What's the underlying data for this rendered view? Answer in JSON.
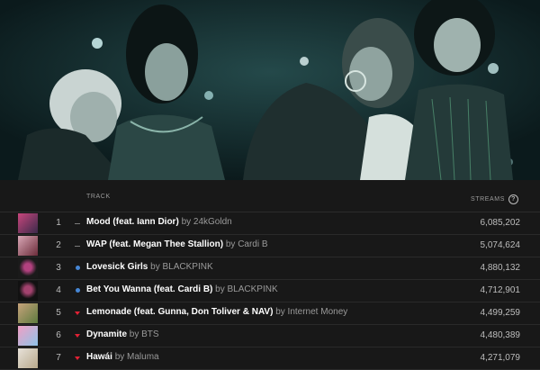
{
  "header": {
    "track_label": "TRACK",
    "streams_label": "STREAMS",
    "info_glyph": "?"
  },
  "by_word": "by",
  "rows": [
    {
      "rank": "1",
      "trend": "flat",
      "title": "Mood (feat. Iann Dior)",
      "artist": "24kGoldn",
      "streams": "6,085,202",
      "thumb_colors": [
        "#c8467c",
        "#3a2a4a"
      ]
    },
    {
      "rank": "2",
      "trend": "flat",
      "title": "WAP (feat. Megan Thee Stallion)",
      "artist": "Cardi B",
      "streams": "5,074,624",
      "thumb_colors": [
        "#d9a7b6",
        "#6b2c3a"
      ]
    },
    {
      "rank": "3",
      "trend": "new",
      "title": "Lovesick Girls",
      "artist": "BLACKPINK",
      "streams": "4,880,132",
      "thumb_colors": [
        "#1a1a1a",
        "#b2417f"
      ]
    },
    {
      "rank": "4",
      "trend": "new",
      "title": "Bet You Wanna (feat. Cardi B)",
      "artist": "BLACKPINK",
      "streams": "4,712,901",
      "thumb_colors": [
        "#111111",
        "#a3426e"
      ]
    },
    {
      "rank": "5",
      "trend": "down",
      "title": "Lemonade (feat. Gunna, Don Toliver & NAV)",
      "artist": "Internet Money",
      "streams": "4,499,259",
      "thumb_colors": [
        "#c7a37b",
        "#5d7a3e"
      ]
    },
    {
      "rank": "6",
      "trend": "down",
      "title": "Dynamite",
      "artist": "BTS",
      "streams": "4,480,389",
      "thumb_colors": [
        "#f19fc4",
        "#8fc3e8"
      ]
    },
    {
      "rank": "7",
      "trend": "down",
      "title": "Hawái",
      "artist": "Maluma",
      "streams": "4,271,079",
      "thumb_colors": [
        "#e7e2da",
        "#b9a98c"
      ]
    }
  ]
}
